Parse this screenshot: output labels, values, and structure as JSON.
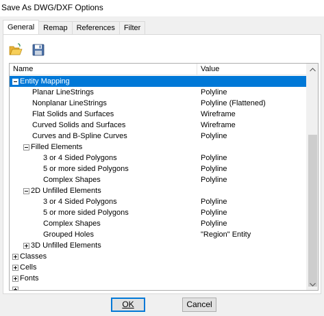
{
  "window": {
    "title": "Save As DWG/DXF Options"
  },
  "tabs": [
    {
      "label": "General",
      "active": true
    },
    {
      "label": "Remap",
      "active": false
    },
    {
      "label": "References",
      "active": false
    },
    {
      "label": "Filter",
      "active": false
    }
  ],
  "toolbar": {
    "open_icon": "folder-open-icon",
    "save_icon": "floppy-save-icon"
  },
  "tree": {
    "columns": {
      "name": "Name",
      "value": "Value"
    },
    "rows": [
      {
        "name": "Entity Mapping",
        "value": "",
        "level": 0,
        "expander": "minus",
        "selected": true
      },
      {
        "name": "Planar LineStrings",
        "value": "Polyline",
        "level": 1,
        "expander": "",
        "selected": false
      },
      {
        "name": "Nonplanar LineStrings",
        "value": "Polyline (Flattened)",
        "level": 1,
        "expander": "",
        "selected": false
      },
      {
        "name": "Flat Solids and Surfaces",
        "value": "Wireframe",
        "level": 1,
        "expander": "",
        "selected": false
      },
      {
        "name": "Curved Solids and Surfaces",
        "value": "Wireframe",
        "level": 1,
        "expander": "",
        "selected": false
      },
      {
        "name": "Curves and B-Spline Curves",
        "value": "Polyline",
        "level": 1,
        "expander": "",
        "selected": false
      },
      {
        "name": "Filled Elements",
        "value": "",
        "level": 1,
        "expander": "minus",
        "selected": false
      },
      {
        "name": "3 or 4 Sided Polygons",
        "value": "Polyline",
        "level": 2,
        "expander": "",
        "selected": false
      },
      {
        "name": "5 or more sided Polygons",
        "value": "Polyline",
        "level": 2,
        "expander": "",
        "selected": false
      },
      {
        "name": "Complex Shapes",
        "value": "Polyline",
        "level": 2,
        "expander": "",
        "selected": false
      },
      {
        "name": "2D Unfilled Elements",
        "value": "",
        "level": 1,
        "expander": "minus",
        "selected": false
      },
      {
        "name": "3 or 4 Sided Polygons",
        "value": "Polyline",
        "level": 2,
        "expander": "",
        "selected": false
      },
      {
        "name": "5 or more sided Polygons",
        "value": "Polyline",
        "level": 2,
        "expander": "",
        "selected": false
      },
      {
        "name": "Complex Shapes",
        "value": "Polyline",
        "level": 2,
        "expander": "",
        "selected": false
      },
      {
        "name": "Grouped Holes",
        "value": "\"Region\" Entity",
        "level": 2,
        "expander": "",
        "selected": false
      },
      {
        "name": "3D Unfilled Elements",
        "value": "",
        "level": 1,
        "expander": "plus",
        "selected": false
      },
      {
        "name": "Classes",
        "value": "",
        "level": 0,
        "expander": "plus",
        "selected": false
      },
      {
        "name": "Cells",
        "value": "",
        "level": 0,
        "expander": "plus",
        "selected": false
      },
      {
        "name": "Fonts",
        "value": "",
        "level": 0,
        "expander": "plus",
        "selected": false
      },
      {
        "name": "",
        "value": "",
        "level": 0,
        "expander": "plus",
        "selected": false
      }
    ]
  },
  "buttons": {
    "ok": "OK",
    "cancel": "Cancel"
  },
  "colors": {
    "selection": "#0078d7",
    "panel": "#ffffff",
    "chrome": "#f0f0f0"
  }
}
